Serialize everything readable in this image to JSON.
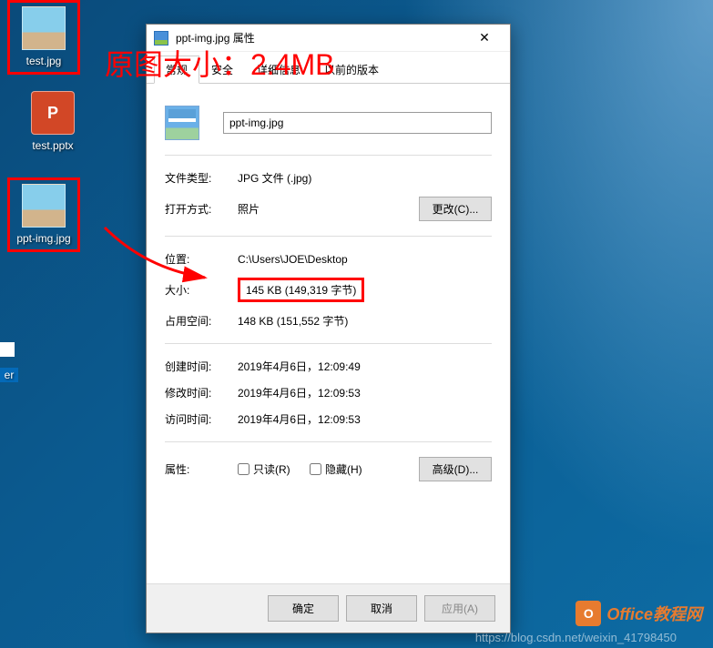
{
  "desktop": {
    "icons": [
      {
        "label": "test.jpg"
      },
      {
        "label": "test.pptx"
      },
      {
        "label": "ppt-img.jpg"
      }
    ]
  },
  "annotation": {
    "text": "原图大小：2.4MB"
  },
  "dialog": {
    "title": "ppt-img.jpg 属性",
    "close": "✕",
    "tabs": [
      "常规",
      "安全",
      "详细信息",
      "以前的版本"
    ],
    "filename": "ppt-img.jpg",
    "rows": {
      "filetype_k": "文件类型:",
      "filetype_v": "JPG 文件 (.jpg)",
      "openwith_k": "打开方式:",
      "openwith_v": "照片",
      "change_btn": "更改(C)...",
      "location_k": "位置:",
      "location_v": "C:\\Users\\JOE\\Desktop",
      "size_k": "大小:",
      "size_v": "145 KB (149,319 字节)",
      "sizeondisk_k": "占用空间:",
      "sizeondisk_v": "148 KB (151,552 字节)",
      "created_k": "创建时间:",
      "created_v": "2019年4月6日，12:09:49",
      "modified_k": "修改时间:",
      "modified_v": "2019年4月6日，12:09:53",
      "accessed_k": "访问时间:",
      "accessed_v": "2019年4月6日，12:09:53",
      "attrs_k": "属性:",
      "readonly": "只读(R)",
      "hidden": "隐藏(H)",
      "advanced": "高级(D)..."
    },
    "buttons": {
      "ok": "确定",
      "cancel": "取消",
      "apply": "应用(A)"
    }
  },
  "watermark": {
    "logo_text": "Office教程网",
    "url": "https://blog.csdn.net/weixin_41798450"
  }
}
